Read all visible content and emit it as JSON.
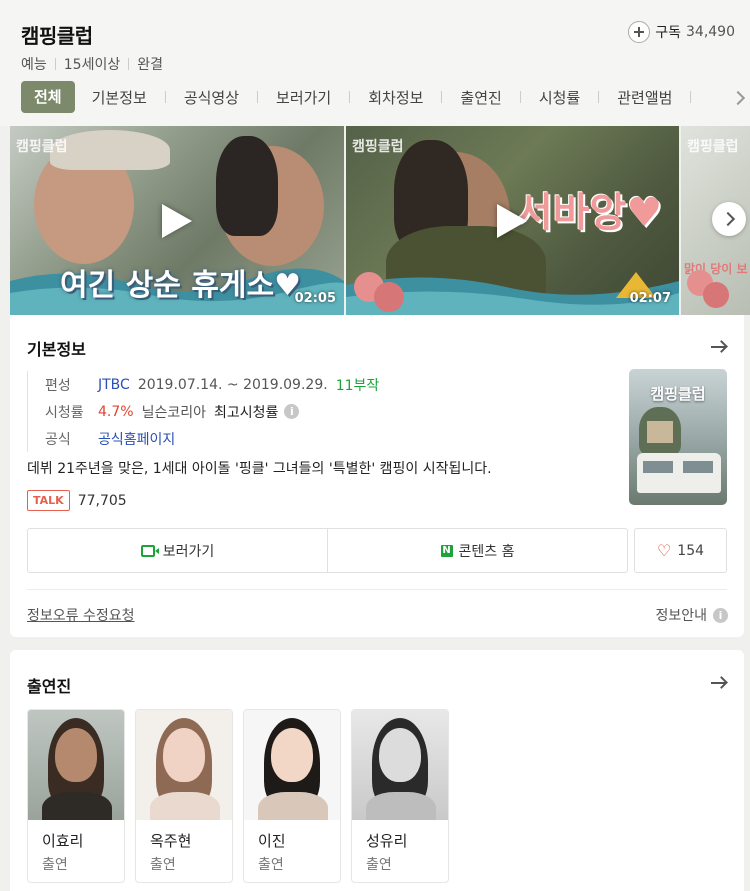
{
  "header": {
    "title": "캠핑클럽",
    "subscribe_label": "구독",
    "subscriber_count": "34,490",
    "meta": [
      "예능",
      "15세이상",
      "완결"
    ]
  },
  "tabs": [
    "전체",
    "기본정보",
    "공식영상",
    "보러가기",
    "회차정보",
    "출연진",
    "시청률",
    "관련앨범"
  ],
  "videos": [
    {
      "logo": "캠핑클럽",
      "caption": "여긴 상순 휴게소♥",
      "duration": "02:05"
    },
    {
      "logo": "캠핑클럽",
      "caption": "서바앙♥",
      "duration": "02:07"
    },
    {
      "logo": "캠핑클럽",
      "caption": "맑이 당이 보",
      "duration": ""
    }
  ],
  "info": {
    "section_title": "기본정보",
    "rows": {
      "broadcast": {
        "key": "편성",
        "channel": "JTBC",
        "period": "2019.07.14. ~ 2019.09.29.",
        "episodes": "11부작"
      },
      "rating": {
        "key": "시청률",
        "value": "4.7%",
        "source": "닐슨코리아",
        "label": "최고시청률"
      },
      "official": {
        "key": "공식",
        "link": "공식홈페이지"
      }
    },
    "poster_title": "캠핑클럽",
    "description": "데뷔 21주년을 맞은, 1세대 아이돌 '핑클' 그녀들의 '특별한' 캠핑이 시작됩니다.",
    "talk_badge": "TALK",
    "talk_count": "77,705",
    "watch_button": "보러가기",
    "naver_icon": "N",
    "content_home_button": "콘텐츠 홈",
    "like_count": "154",
    "report_link": "정보오류 수정요청",
    "info_guide": "정보안내"
  },
  "cast": {
    "section_title": "출연진",
    "members": [
      {
        "name": "이효리",
        "role": "출연"
      },
      {
        "name": "옥주현",
        "role": "출연"
      },
      {
        "name": "이진",
        "role": "출연"
      },
      {
        "name": "성유리",
        "role": "출연"
      }
    ]
  },
  "colors": {
    "tab_active_bg": "#7c8a6b",
    "link_blue": "#2b50b5",
    "accent_green": "#1da33c",
    "rating_red": "#e0442f"
  }
}
